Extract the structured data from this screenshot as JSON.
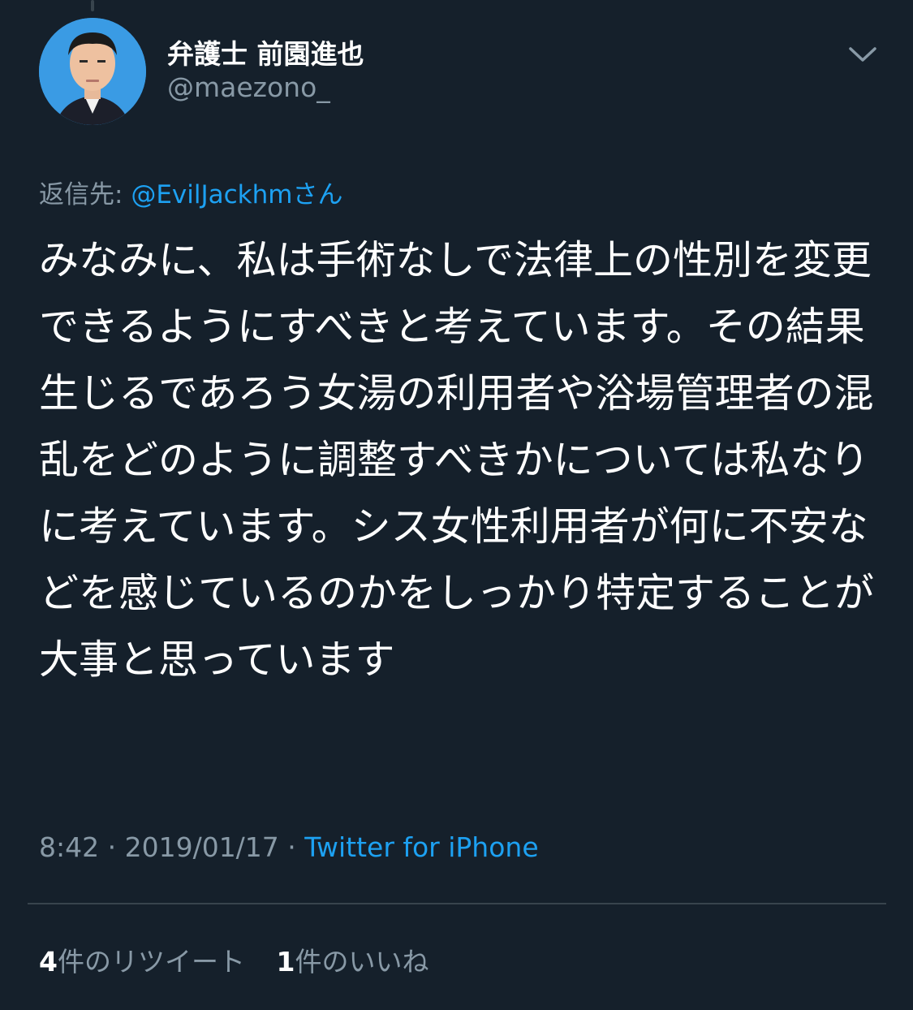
{
  "tweet": {
    "display_name": "弁護士 前園進也",
    "handle": "@maezono_",
    "reply_prefix": "返信先: ",
    "reply_to": "@EvilJackhmさん",
    "text": "みなみに、私は手術なしで法律上の性別を変更できるようにすべきと考えています。その結果生じるであろう女湯の利用者や浴場管理者の混乱をどのように調整すべきかについては私なりに考えています。シス女性利用者が何に不安などを感じているのかをしっかり特定することが大事と思っています",
    "time": "8:42",
    "separator": " · ",
    "date": "2019/01/17",
    "source": "Twitter for iPhone"
  },
  "stats": {
    "retweets_count": "4",
    "retweets_label": "件のリツイート",
    "likes_count": "1",
    "likes_label": "件のいいね"
  },
  "icons": {
    "caret": "chevron-down-icon",
    "avatar": "avatar-photo"
  },
  "colors": {
    "background": "#15202b",
    "text_primary": "#ffffff",
    "text_secondary": "#8899a6",
    "accent": "#1da1f2",
    "divider": "#38444d"
  }
}
